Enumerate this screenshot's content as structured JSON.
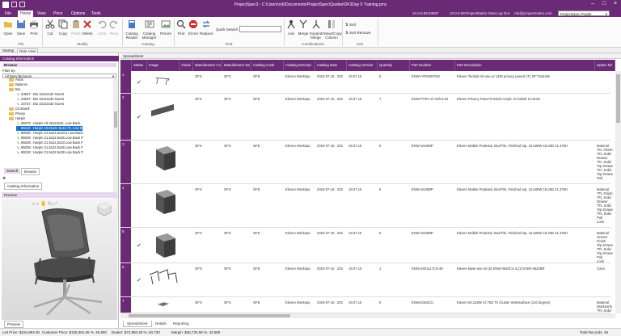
{
  "window": {
    "title": "ProjectSpec3  -  C:\\Users\\rs6\\Documents\\ProjectSpec\\Quotes\\OF3Day 5 Training.pmc"
  },
  "menu": {
    "items": [
      "File",
      "Home",
      "View",
      "Price",
      "Options",
      "Tools"
    ],
    "active": "Home",
    "version": "10.0.0.89:53697",
    "data_version": "10.0.0.89:ProjectMatrix Data",
    "logout": "Log Out",
    "email": "rob@projectmatrix.com",
    "theme": "ProjectSpec Purple"
  },
  "ribbon": {
    "file_buttons": [
      "Open",
      "Save",
      "Print"
    ],
    "modify_buttons": [
      "Cut",
      "Copy",
      "Paste",
      "Delete",
      "Undo",
      "Redo"
    ],
    "catalog_buttons": [
      "Catalog Reader",
      "Catalog Manager",
      "Picture"
    ],
    "find_buttons": [
      "Find",
      "Errors",
      "Replace"
    ],
    "quick_search_label": "Quick Search:",
    "combination_buttons": [
      "Join",
      "Merge",
      "Expand/ Merge",
      "Move/Copy Column"
    ],
    "sort_items": [
      "Sort",
      "Sort Remove"
    ],
    "groups": [
      "File",
      "Modify",
      "Catalog",
      "Find",
      "Combinations",
      "Sort"
    ]
  },
  "view_tabs": [
    "Startup",
    "Data View"
  ],
  "left": {
    "header": "Catalog Information",
    "browse_label": "Browse",
    "filter_label": "Filter by:",
    "filter_value": "All Manufacturers",
    "tree": [
      {
        "label": "Aeus",
        "type": "folder",
        "indent": 1
      },
      {
        "label": "Balance",
        "type": "folder",
        "indent": 1
      },
      {
        "label": "Bio",
        "type": "folder",
        "indent": 1
      },
      {
        "label": "23637 : Bio 22x22x32 Guest",
        "type": "item",
        "indent": 2
      },
      {
        "label": "23637 : Bio 22x22x32 Guest",
        "type": "item",
        "indent": 2
      },
      {
        "label": "23737 : Bio 22x22x32 Guest",
        "type": "item",
        "indent": 2
      },
      {
        "label": "Cromwell",
        "type": "folder",
        "indent": 1
      },
      {
        "label": "Flexxy",
        "type": "folder",
        "indent": 1
      },
      {
        "label": "Harpin",
        "type": "folder",
        "indent": 1
      },
      {
        "label": "85076 : Harpin 19.25x23x34, Low Back",
        "type": "item",
        "indent": 2
      },
      {
        "label": "85119 : Harpin 19.25x21.5x34.75, Low B",
        "type": "item",
        "indent": 2,
        "selected": true
      },
      {
        "label": "85036 : Harpin 21.5x22.5x33.5 Low Back",
        "type": "item",
        "indent": 2
      },
      {
        "label": "85039 : Harpin 21.5x22.5x35 Low Back P",
        "type": "item",
        "indent": 2
      },
      {
        "label": "85039 : Harpin 21.5x22.5x33 Low Back F",
        "type": "item",
        "indent": 2
      },
      {
        "label": "85039 : Harpin 21.5x22.5x35 Low Back F",
        "type": "item",
        "indent": 2
      },
      {
        "label": "85138 : Harpin 21.5x22.5x36 Low Back P",
        "type": "item",
        "indent": 2
      }
    ],
    "tabs": [
      "Search",
      "Browse"
    ],
    "info_tab": "Catalog Information",
    "preview_label": "Preview",
    "preview_tab": "Preview"
  },
  "spreadsheet": {
    "title": "Spreadsheet",
    "columns": [
      "Status",
      "Image",
      "Visual",
      "Manufacturer Co",
      "Manufacturer De",
      "Catalog Code",
      "Catalog Descript",
      "Catalog Date",
      "Catalog Version",
      "Quantity",
      "Part Number",
      "Part Description",
      "Option De"
    ],
    "rows": [
      {
        "num": "1",
        "status": true,
        "image": "table-frame",
        "mfr_code": "OFS",
        "mfr_desc": "OFS",
        "cat_code": "OFE",
        "cat_desc": "Eleven Workspa",
        "date": "2019-07-15 : 202",
        "version": "19.07.15",
        "qty": "5",
        "part": "ENW-ATR48STKB",
        "desc": "Eleven Toolrail Kit-use w/ 14ID privacy panels (T) 48\" Toolrails",
        "options": []
      },
      {
        "num": "2",
        "status": true,
        "image": "panel",
        "mfr_code": "OFS",
        "mfr_desc": "OFS",
        "cat_code": "OFE",
        "cat_desc": "Eleven Workspa",
        "date": "2019-07-15 : 202",
        "version": "19.07.15",
        "qty": "7",
        "part": "ENW-PVPA-47.63/12.81",
        "desc": "Eleven Privacy Panel-Frosted Acrylic 47.625W 12.812H",
        "options": []
      },
      {
        "num": "3",
        "status": false,
        "image": "pedestal",
        "mfr_code": "OFS",
        "mfr_desc": "OFS",
        "cat_code": "OFE",
        "cat_desc": "Eleven Workspa",
        "date": "2019-07-15 : 202",
        "version": "19.07.15",
        "qty": "6",
        "part": "ENW-1619MP",
        "desc": "Eleven Mobile Pedestal, Box/File, Finished top, 15.625W 19.25D 21.375H",
        "options": [
          "Material",
          "TFL Finish",
          "TFL Solid",
          "Drawer",
          "TFL Solid",
          "Top Drawe",
          "TFL Solid",
          "Top Drawe",
          "Pull"
        ]
      },
      {
        "num": "4",
        "status": false,
        "image": "pedestal",
        "mfr_code": "OFS",
        "mfr_desc": "OFS",
        "cat_code": "OFE",
        "cat_desc": "Eleven Workspa",
        "date": "2019-07-15 : 202",
        "version": "19.07.15",
        "qty": "6",
        "part": "ENW-1619MP",
        "desc": "Eleven Mobile Pedestal, Box/File, Finished top, 15.625W 19.25D 21.375H",
        "options": [
          "Material",
          "TFL Finish",
          "TFL Solid",
          "Drawer",
          "TFL Solid",
          "Top Drawe",
          "TFL Solid",
          "Pull",
          "Lock"
        ]
      },
      {
        "num": "5",
        "status": true,
        "image": "pedestal",
        "mfr_code": "OFS",
        "mfr_desc": "OFS",
        "cat_code": "OFE",
        "cat_desc": "Eleven Workspa",
        "date": "2019-07-15 : 202",
        "version": "19.07.15",
        "qty": "6",
        "part": "ENW-1619MP",
        "desc": "Eleven Mobile Pedestal, Box/File, Finished top, 15.625W 19.25D 21.375H",
        "options": [
          "Material",
          "Veneer",
          "Finish",
          "Top Drawe",
          "TFL Solid",
          "Top Drawe",
          "Pull",
          "Lock"
        ]
      },
      {
        "num": "6",
        "status": true,
        "image": "base-frames",
        "mfr_code": "OFS",
        "mfr_desc": "OFS",
        "cat_code": "OFE",
        "cat_desc": "Eleven Workspa",
        "date": "2019-07-15 : 202",
        "version": "19.07.15",
        "qty": "1",
        "part": "ENW-2401117CS-48",
        "desc": "Eleven Base-use w/ (6) ENW-0545CU & (2) ENW-4824BR",
        "options": [
          "Color"
        ]
      },
      {
        "num": "7",
        "status": false,
        "image": "worksurface",
        "mfr_code": "OFS",
        "mfr_desc": "OFS",
        "cat_code": "OFE",
        "cat_desc": "Eleven Workspa",
        "date": "2019-07-15 : 202",
        "version": "19.07.15",
        "qty": "6",
        "part": "ENW-E345CU",
        "desc": "Eleven 63.125W 47.75D Tri Cluster Worksurface (120 degree)",
        "options": [
          "Material",
          "Worksurfa",
          "TFL Solid"
        ]
      }
    ]
  },
  "bottom_tabs": [
    "Spreadsheet",
    "Details",
    "Reporting"
  ],
  "status": {
    "list_price": "List Price: $194,954.00",
    "customer_price": "Customer Price: $109,381.06  %: 40.860",
    "dealer": "Dealer: $72,850.48  %: 60.720",
    "margin": "Margin: $36,730.58  %: 33.580",
    "total_records": "Total Records: 49"
  },
  "colors": {
    "brand": "#6a2a76",
    "ok": "#2a9b2a",
    "selection": "#1a73c9"
  }
}
